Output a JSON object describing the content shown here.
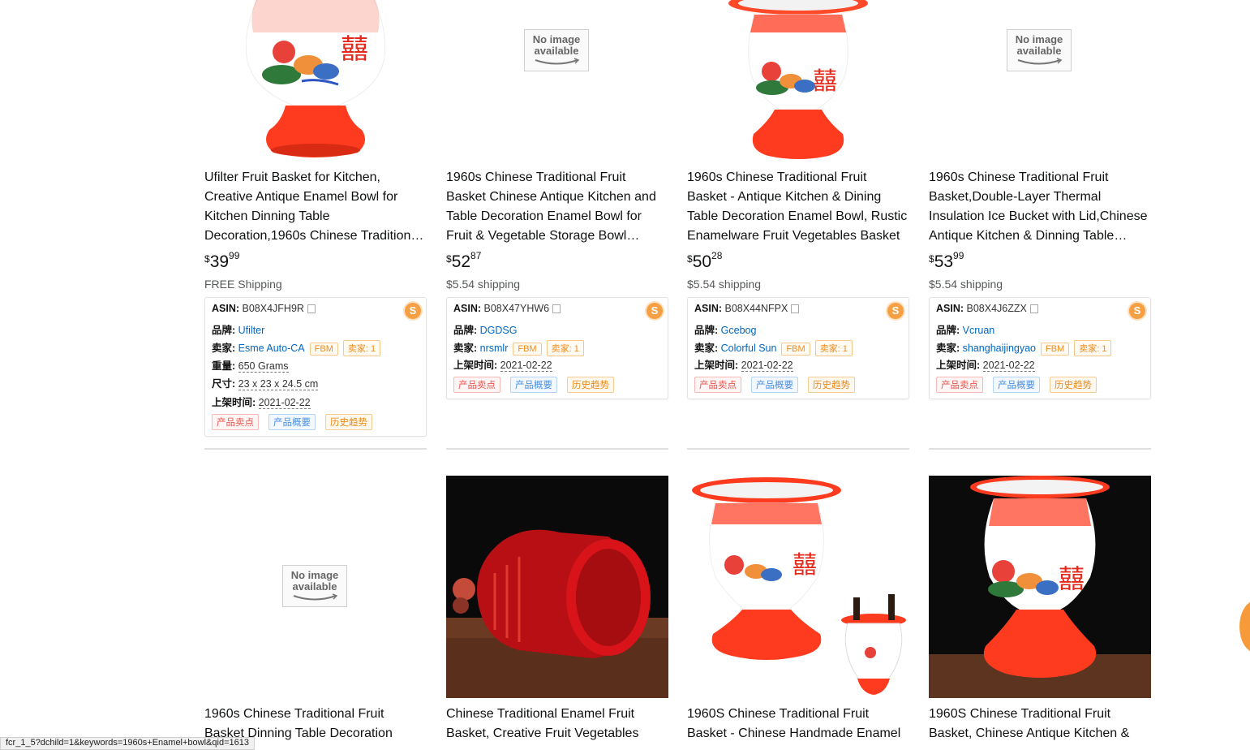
{
  "products": [
    {
      "title": "Ufilter Fruit Basket for Kitchen, Creative Antique Enamel Bowl for Kitchen Dinning Table Decoration,1960s Chinese Traditional Fruit Basket",
      "price_currency": "$",
      "price_whole": "39",
      "price_fraction": "99",
      "shipping": "FREE Shipping",
      "image": "red-enamel-vase",
      "asin_label": "ASIN:",
      "asin": "B08X4JFH9R",
      "brand_label": "品牌:",
      "brand": "Ufilter",
      "seller_label": "卖家:",
      "seller": "Esme Auto-CA",
      "fbm": "FBM",
      "seller_count": "卖家: 1",
      "weight_label": "重量:",
      "weight": "650 Grams",
      "size_label": "尺寸:",
      "size": "23 x 23 x 24.5 cm",
      "date_label": "上架时间:",
      "date": "2021-02-22",
      "btn_points": "产品卖点",
      "btn_overview": "产品概要",
      "btn_history": "历史趋势"
    },
    {
      "title": "1960s Chinese Traditional Fruit Basket Chinese Antique Kitchen and Table Decoration Enamel Bowl for Fruit & Vegetable Storage Bowl Basket",
      "price_currency": "$",
      "price_whole": "52",
      "price_fraction": "87",
      "shipping": "$5.54 shipping",
      "image": "no-image",
      "asin_label": "ASIN:",
      "asin": "B08X47YHW6",
      "brand_label": "品牌:",
      "brand": "DGDSG",
      "seller_label": "卖家:",
      "seller": "nrsmlr",
      "fbm": "FBM",
      "seller_count": "卖家: 1",
      "date_label": "上架时间:",
      "date": "2021-02-22",
      "btn_points": "产品卖点",
      "btn_overview": "产品概要",
      "btn_history": "历史趋势"
    },
    {
      "title": "1960s Chinese Traditional Fruit Basket - Antique Kitchen & Dining Table Decoration Enamel Bowl, Rustic Enamelware Fruit Vegetables Basket",
      "price_currency": "$",
      "price_whole": "50",
      "price_fraction": "28",
      "shipping": "$5.54 shipping",
      "image": "red-enamel-spittoon",
      "asin_label": "ASIN:",
      "asin": "B08X44NFPX",
      "brand_label": "品牌:",
      "brand": "Gcebog",
      "seller_label": "卖家:",
      "seller": "Colorful Sun",
      "fbm": "FBM",
      "seller_count": "卖家: 1",
      "date_label": "上架时间:",
      "date": "2021-02-22",
      "btn_points": "产品卖点",
      "btn_overview": "产品概要",
      "btn_history": "历史趋势"
    },
    {
      "title": "1960s Chinese Traditional Fruit Basket,Double-Layer Thermal Insulation Ice Bucket with Lid,Chinese Antique Kitchen & Dinning Table Decoration",
      "price_currency": "$",
      "price_whole": "53",
      "price_fraction": "99",
      "shipping": "$5.54 shipping",
      "image": "no-image",
      "asin_label": "ASIN:",
      "asin": "B08X4J6ZZX",
      "brand_label": "品牌:",
      "brand": "Vcruan",
      "seller_label": "卖家:",
      "seller": "shanghaijingyao",
      "fbm": "FBM",
      "seller_count": "卖家: 1",
      "date_label": "上架时间:",
      "date": "2021-02-22",
      "btn_points": "产品卖点",
      "btn_overview": "产品概要",
      "btn_history": "历史趋势"
    }
  ],
  "products_row2": [
    {
      "title": "1960s Chinese Traditional Fruit Basket Dinning Table Decoration",
      "image": "no-image"
    },
    {
      "title": "Chinese Traditional Enamel Fruit Basket, Creative Fruit Vegetables",
      "image": "red-bowl-photo"
    },
    {
      "title": "1960S Chinese Traditional Fruit Basket - Chinese Handmade Enamel",
      "image": "enamel-vase-with-bucket"
    },
    {
      "title": "1960S Chinese Traditional Fruit Basket, Chinese Antique Kitchen &",
      "image": "enamel-vase-dark-bg"
    }
  ],
  "no_image_text": [
    "No image",
    "available"
  ],
  "badge_letter": "S",
  "status_bar": "fcr_1_5?dchild=1&keywords=1960s+Enamel+bowl&qid=1613",
  "colors": {
    "accent_orange": "#f7a043",
    "link_blue": "#0066c0",
    "enamel_red": "#e8321e"
  }
}
